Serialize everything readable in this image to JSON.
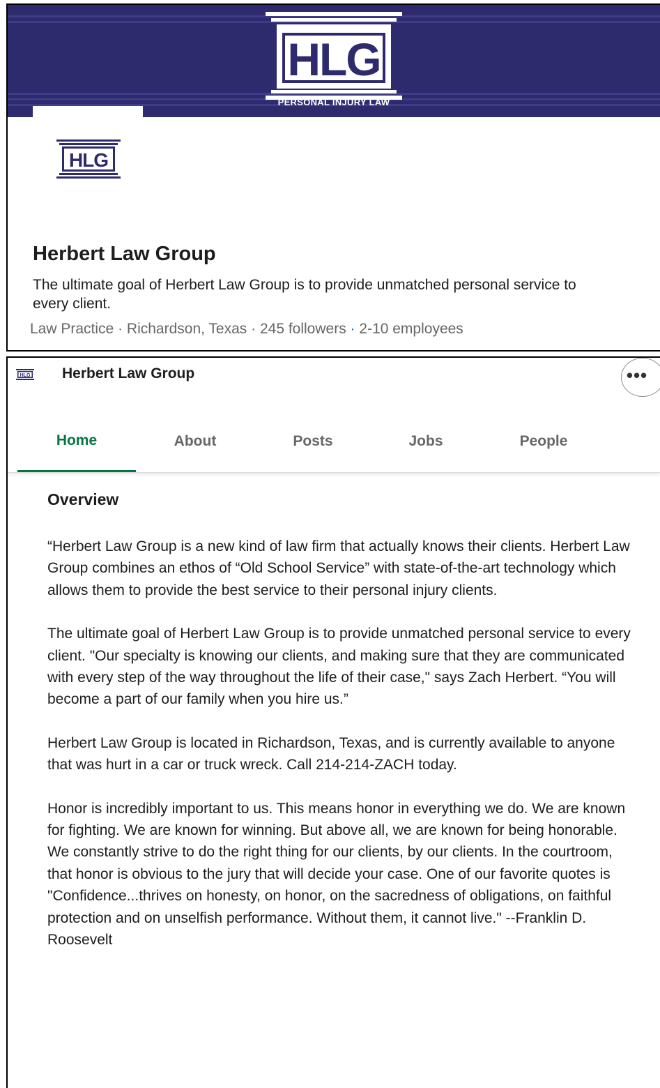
{
  "banner": {
    "logo_text": "HLG",
    "tagline": "PERSONAL INJURY LAW"
  },
  "company": {
    "name": "Herbert Law Group",
    "tagline": "The ultimate goal of Herbert Law Group is to provide unmatched personal service to every client.",
    "industry": "Law Practice",
    "location": "Richardson, Texas",
    "followers": "245 followers",
    "employees": "2-10 employees",
    "separator": "·"
  },
  "sticky_header": {
    "name": "Herbert Law Group",
    "more_label": "•••"
  },
  "tabs": [
    {
      "label": "Home",
      "active": true
    },
    {
      "label": "About",
      "active": false
    },
    {
      "label": "Posts",
      "active": false
    },
    {
      "label": "Jobs",
      "active": false
    },
    {
      "label": "People",
      "active": false
    }
  ],
  "overview": {
    "heading": "Overview",
    "paragraphs": [
      "“Herbert Law Group is a new kind of law firm that actually knows their clients. Herbert Law Group combines an ethos of “Old School Service” with state-of-the-art technology which allows them to provide the best service to their personal injury clients.",
      "The ultimate goal of Herbert Law Group is to provide unmatched personal service to every client. \"Our specialty is knowing our clients, and making sure that they are communicated with every step of the way throughout the life of their case,\" says Zach Herbert. “You will become a part of our family when you hire us.”",
      "Herbert Law Group is located in Richardson, Texas, and is currently available to anyone that was hurt in a car or truck wreck. Call 214-214-ZACH today.",
      "Honor is incredibly important to us. This means honor in everything we do. We are known for fighting. We are known for winning. But above all, we are known for being honorable. We constantly strive to do the right thing for our clients, by our clients. In the courtroom, that honor is obvious to the jury that will decide your case. One of our favorite quotes is \"Confidence...thrives on honesty, on honor, on the sacredness of obligations, on faithful protection and on unselfish performance. Without them, it cannot live.\" --Franklin D. Roosevelt"
    ]
  },
  "colors": {
    "banner": "#2e2a6e",
    "active_tab": "#057642",
    "muted_text": "#666666",
    "link_dot": "#0a66c2"
  }
}
